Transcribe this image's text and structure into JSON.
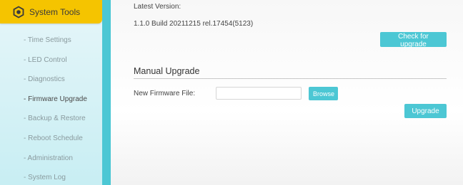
{
  "sidebar": {
    "header": {
      "label": "System Tools",
      "icon": "gear-icon"
    },
    "items": [
      {
        "label": "- Time Settings",
        "active": false
      },
      {
        "label": "- LED Control",
        "active": false
      },
      {
        "label": "- Diagnostics",
        "active": false
      },
      {
        "label": "- Firmware Upgrade",
        "active": true
      },
      {
        "label": "- Backup & Restore",
        "active": false
      },
      {
        "label": "- Reboot Schedule",
        "active": false
      },
      {
        "label": "- Administration",
        "active": false
      },
      {
        "label": "- System Log",
        "active": false
      }
    ]
  },
  "main": {
    "latest_version_label": "Latest Version:",
    "version_value": "1.1.0 Build 20211215 rel.17454(5123)",
    "check_upgrade_label": "Check for upgrade",
    "manual_title": "Manual Upgrade",
    "firmware_file_label": "New Firmware File:",
    "firmware_file_value": "",
    "browse_label": "Browse",
    "upgrade_label": "Upgrade"
  },
  "colors": {
    "accent": "#4cc7d4",
    "header_yellow": "#f5c400",
    "sidebar_bg": "#d6f2f6"
  }
}
